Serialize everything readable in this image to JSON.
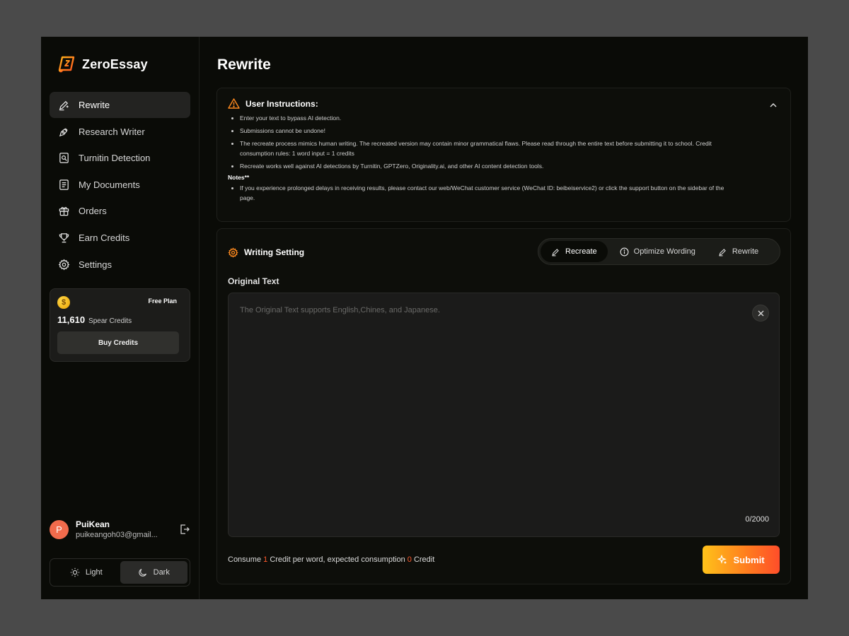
{
  "app": {
    "name": "ZeroEssay",
    "accent": "#ff7a1f"
  },
  "sidebar": {
    "items": [
      {
        "label": "Rewrite",
        "icon": "pen-sparkle-icon",
        "active": true
      },
      {
        "label": "Research Writer",
        "icon": "pen-nib-icon",
        "active": false
      },
      {
        "label": "Turnitin Detection",
        "icon": "doc-search-icon",
        "active": false
      },
      {
        "label": "My Documents",
        "icon": "document-icon",
        "active": false
      },
      {
        "label": "Orders",
        "icon": "gift-icon",
        "active": false
      },
      {
        "label": "Earn Credits",
        "icon": "trophy-icon",
        "active": false
      },
      {
        "label": "Settings",
        "icon": "gear-icon",
        "active": false
      }
    ],
    "credits": {
      "plan": "Free Plan",
      "amount": "11,610",
      "unit": "Spear Credits",
      "buy_label": "Buy Credits",
      "coin_symbol": "$"
    },
    "user": {
      "initial": "P",
      "name": "PuiKean",
      "email": "puikeangoh03@gmail..."
    },
    "theme": {
      "light_label": "Light",
      "dark_label": "Dark",
      "selected": "Dark"
    }
  },
  "main": {
    "title": "Rewrite",
    "instructions": {
      "title": "User Instructions:",
      "items": [
        "Enter your text to bypass AI detection.",
        "Submissions cannot be undone!",
        "The recreate process mimics human writing. The recreated version may contain minor grammatical flaws. Please read through the entire text before submitting it to school. Credit consumption rules: 1 word input = 1 credits",
        "Recreate works well against AI detections by Turnitin, GPTZero, Originality.ai, and other AI content detection tools."
      ],
      "notes_title": "Notes**",
      "notes": [
        "If you experience prolonged delays in receiving results, please contact our web/WeChat customer service (WeChat ID: beibeiservice2) or click the support button on the sidebar of the page."
      ]
    },
    "writing": {
      "title": "Writing Setting",
      "modes": [
        {
          "label": "Recreate",
          "active": true
        },
        {
          "label": "Optimize Wording",
          "active": false
        },
        {
          "label": "Rewrite",
          "active": false
        }
      ],
      "original_label": "Original Text",
      "textarea_value": "",
      "placeholder": "The Original Text supports English,Chines, and Japanese.",
      "char_count": "0/2000",
      "consume_prefix": "Consume ",
      "consume_rate": "1",
      "consume_middle": " Credit per word, expected consumption ",
      "consume_expected": "0",
      "consume_suffix": " Credit",
      "submit_label": "Submit"
    }
  }
}
